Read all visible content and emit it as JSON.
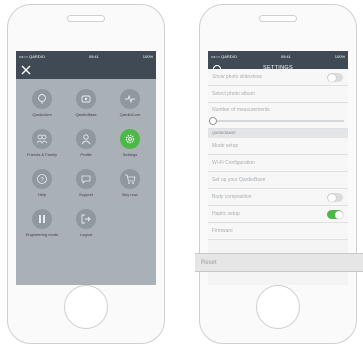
{
  "status": {
    "carrier": "•••○○ QARDIO",
    "time": "09:41",
    "battery": "100%"
  },
  "left": {
    "tiles": [
      {
        "label": "QardioArm",
        "icon": "heart-monitor-icon",
        "active": false
      },
      {
        "label": "QardioBase",
        "icon": "scale-icon",
        "active": false
      },
      {
        "label": "QardioCore",
        "icon": "ecg-icon",
        "active": false
      },
      {
        "label": "Friends & Family",
        "icon": "people-icon",
        "active": false
      },
      {
        "label": "Profile",
        "icon": "person-icon",
        "active": false
      },
      {
        "label": "Settings",
        "icon": "gear-icon",
        "active": true
      },
      {
        "label": "Help",
        "icon": "question-icon",
        "active": false
      },
      {
        "label": "Support",
        "icon": "chat-icon",
        "active": false
      },
      {
        "label": "Buy now",
        "icon": "cart-icon",
        "active": false
      },
      {
        "label": "Engineering mode",
        "icon": "sliders-icon",
        "active": false
      },
      {
        "label": "Logout",
        "icon": "logout-icon",
        "active": false
      }
    ]
  },
  "right": {
    "title": "SETTINGS",
    "partial_row": "Show photo slideshow",
    "rows_top": [
      "Select photo album",
      "Number of measurements"
    ],
    "slider_value": 0,
    "section_label": "QARDIOBASE",
    "rows": [
      {
        "label": "Mode setup"
      },
      {
        "label": "Wi-Fi Configuration"
      },
      {
        "label": "Set up your QardioBase"
      },
      {
        "label": "Body composition",
        "toggle": "off"
      },
      {
        "label": "Haptic setup",
        "toggle": "on"
      },
      {
        "label": "Firmware"
      }
    ],
    "reset_label": "Reset"
  }
}
